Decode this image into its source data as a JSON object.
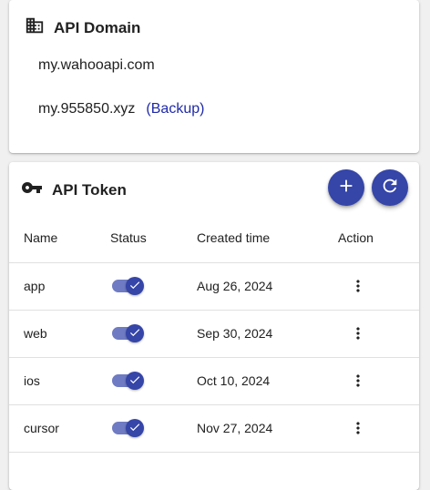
{
  "domain_card": {
    "title": "API Domain",
    "icon": "building-icon",
    "domains": [
      {
        "url": "my.wahooapi.com",
        "note": ""
      },
      {
        "url": "my.955850.xyz",
        "note": "(Backup)"
      }
    ]
  },
  "token_card": {
    "title": "API Token",
    "icon": "key-icon",
    "actions": {
      "add": "add-icon",
      "refresh": "refresh-icon"
    },
    "columns": {
      "name": "Name",
      "status": "Status",
      "created": "Created time",
      "action": "Action"
    },
    "rows": [
      {
        "name": "app",
        "status": "enabled",
        "created": "Aug 26, 2024"
      },
      {
        "name": "web",
        "status": "enabled",
        "created": "Sep 30, 2024"
      },
      {
        "name": "ios",
        "status": "enabled",
        "created": "Oct 10, 2024"
      },
      {
        "name": "cursor",
        "status": "enabled",
        "created": "Nov 27, 2024"
      }
    ]
  },
  "colors": {
    "primary": "#3545a8",
    "switch_track": "#6f7bc2",
    "link": "#1f2aa8"
  }
}
